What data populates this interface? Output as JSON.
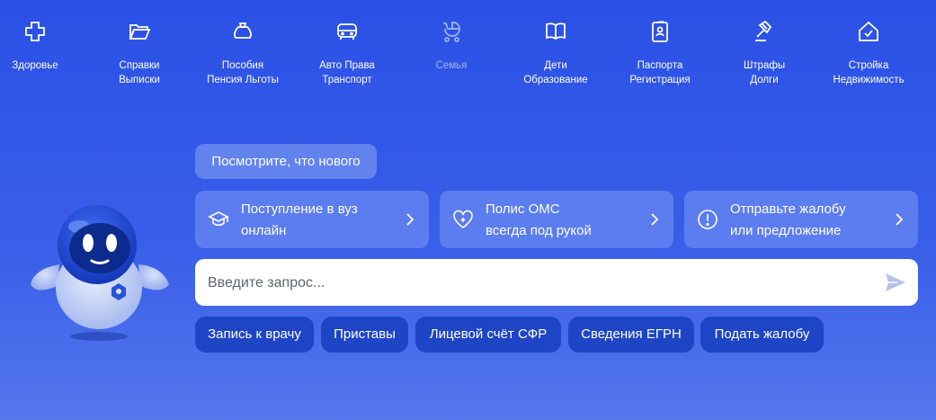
{
  "nav": {
    "items": [
      {
        "label": "Здоровье",
        "icon": "plus-cross-icon"
      },
      {
        "label": "Справки\nВыписки",
        "icon": "folder-icon"
      },
      {
        "label": "Пособия\nПенсия Льготы",
        "icon": "wallet-icon"
      },
      {
        "label": "Авто Права\nТранспорт",
        "icon": "car-icon"
      },
      {
        "label": "Семья",
        "icon": "stroller-icon"
      },
      {
        "label": "Дети\nОбразование",
        "icon": "book-icon"
      },
      {
        "label": "Паспорта\nРегистрация",
        "icon": "passport-icon"
      },
      {
        "label": "Штрафы\nДолги",
        "icon": "gavel-icon"
      },
      {
        "label": "Стройка\nНедвижимость",
        "icon": "house-icon"
      }
    ]
  },
  "news": {
    "label": "Посмотрите, что нового"
  },
  "cards": [
    {
      "label": "Поступление в вуз\nонлайн",
      "icon": "graduation-cap-icon"
    },
    {
      "label": "Полис ОМС\nвсегда под рукой",
      "icon": "heart-plus-icon"
    },
    {
      "label": "Отправьте жалобу\nили предложение",
      "icon": "exclamation-circle-icon"
    }
  ],
  "search": {
    "placeholder": "Введите запрос...",
    "value": ""
  },
  "chips": [
    {
      "label": "Запись к врачу"
    },
    {
      "label": "Приставы"
    },
    {
      "label": "Лицевой счёт СФР"
    },
    {
      "label": "Сведения ЕГРН"
    },
    {
      "label": "Подать жалобу"
    }
  ],
  "colors": {
    "background": "#2a50e6",
    "card": "#5c7def",
    "chip": "#1d45c6",
    "dimmed": "#9fb3f4"
  }
}
